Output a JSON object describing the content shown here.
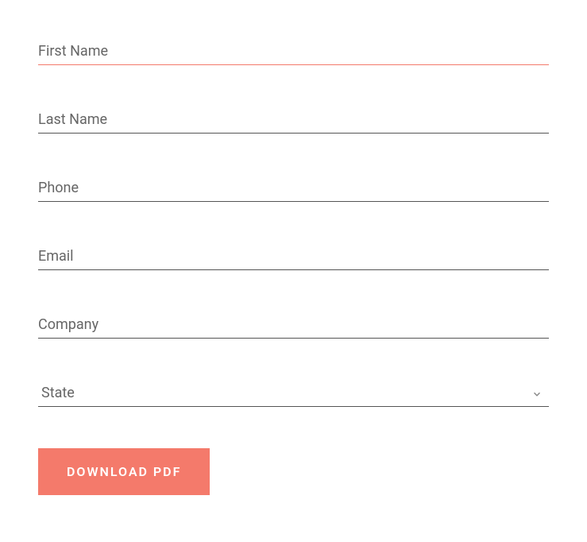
{
  "form": {
    "fields": {
      "first_name": {
        "placeholder": "First Name",
        "value": ""
      },
      "last_name": {
        "placeholder": "Last Name",
        "value": ""
      },
      "phone": {
        "placeholder": "Phone",
        "value": ""
      },
      "email": {
        "placeholder": "Email",
        "value": ""
      },
      "company": {
        "placeholder": "Company",
        "value": ""
      },
      "state": {
        "placeholder": "State",
        "selected": "State"
      }
    },
    "button": {
      "label": "DOWNLOAD PDF"
    },
    "colors": {
      "accent": "#f47a6b",
      "text": "#666",
      "border": "#555"
    }
  }
}
